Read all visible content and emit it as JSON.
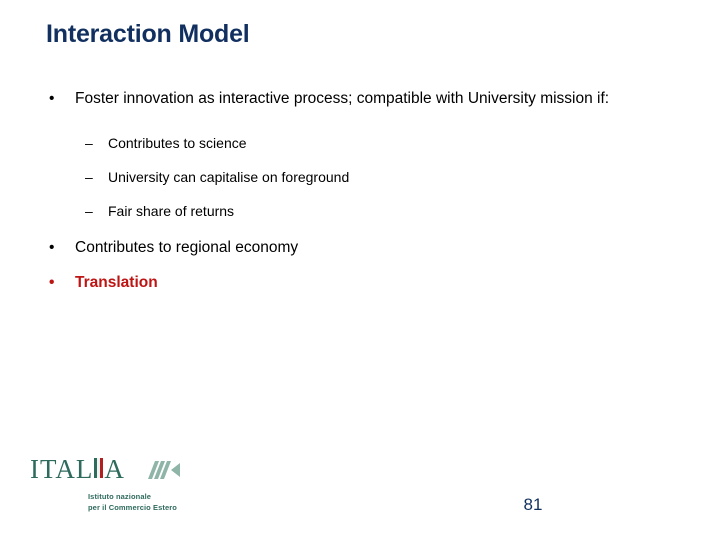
{
  "slide": {
    "title": "Interaction Model",
    "page_number": "81",
    "colors": {
      "title": "#12305f",
      "body_text": "#000000",
      "accent_red": "#bd1414",
      "logo_green": "#2f6b5d",
      "logo_mark_green": "#8fb4a8",
      "background": "#ffffff"
    },
    "bullets": [
      {
        "level": 1,
        "marker": "•",
        "text": "Foster innovation as interactive process; compatible with University mission if:",
        "emphasis": "none"
      },
      {
        "level": 2,
        "marker": "–",
        "text": "Contributes to science",
        "emphasis": "none"
      },
      {
        "level": 2,
        "marker": "–",
        "text": "University can capitalise on foreground",
        "emphasis": "none"
      },
      {
        "level": 2,
        "marker": "–",
        "text": "Fair share of returns",
        "emphasis": "none"
      },
      {
        "level": 1,
        "marker": "•",
        "text": "Contributes to regional economy",
        "emphasis": "none"
      },
      {
        "level": 1,
        "marker": "•",
        "text": "Translation",
        "emphasis": "red-bold"
      }
    ]
  },
  "logo": {
    "wordmark_part1": "ITAL",
    "wordmark_part2": "A",
    "mark_icon": "chevron-stripes-icon",
    "subtitle_line1": "Istituto nazionale",
    "subtitle_line2": "per il Commercio Estero"
  }
}
